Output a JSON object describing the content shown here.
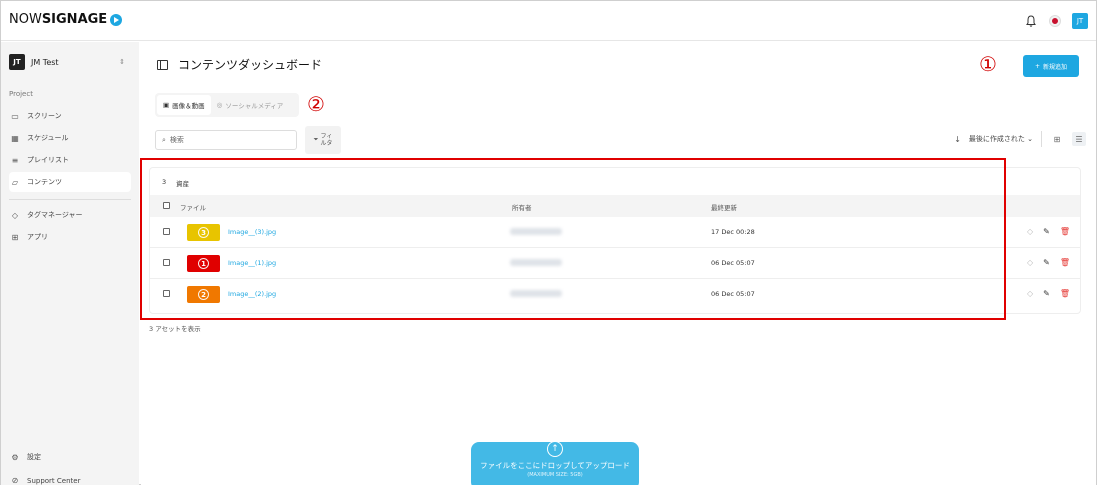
{
  "app": {
    "logo_prefix": "NOW",
    "logo_bold": "SIGNAGE"
  },
  "topbar": {
    "bell_icon": "bell-icon",
    "locale_flag": "japan-flag",
    "user_initials": "JT"
  },
  "sidebar": {
    "workspace_badge": "JT",
    "workspace_name": "JM Test",
    "section_label": "Project",
    "items": [
      {
        "icon": "screen-icon",
        "label": "スクリーン"
      },
      {
        "icon": "calendar-icon",
        "label": "スケジュール"
      },
      {
        "icon": "playlist-icon",
        "label": "プレイリスト"
      },
      {
        "icon": "folder-icon",
        "label": "コンテンツ"
      },
      {
        "icon": "tag-icon",
        "label": "タグマネージャー"
      },
      {
        "icon": "apps-icon",
        "label": "アプリ"
      }
    ],
    "settings_label": "設定",
    "support_label": "Support Center"
  },
  "page": {
    "title": "コンテンツダッシュボード",
    "add_button": "新規追加",
    "annotation_1": "①",
    "annotation_2": "②",
    "tabs": [
      {
        "label": "画像＆動画",
        "active": true
      },
      {
        "label": "ソーシャルメディア",
        "active": false
      }
    ],
    "search_placeholder": "検索",
    "filter_label_line1": "フィ",
    "filter_label_line2": "ルタ",
    "sort_label": "最後に作成された"
  },
  "table": {
    "count": "3",
    "count_label": "資産",
    "headers": {
      "file": "ファイル",
      "owner": "所有者",
      "updated": "最終更新"
    },
    "rows": [
      {
        "thumb_color": "#e8c400",
        "thumb_num": "3",
        "filename": "Image__(3).jpg",
        "updated": "17 Dec 00:28"
      },
      {
        "thumb_color": "#e00000",
        "thumb_num": "1",
        "filename": "Image__(1).jpg",
        "updated": "06 Dec 05:07"
      },
      {
        "thumb_color": "#f07800",
        "thumb_num": "2",
        "filename": "Image__(2).jpg",
        "updated": "06 Dec 05:07"
      }
    ],
    "footer": "3 アセットを表示"
  },
  "upload": {
    "label": "ファイルをここにドロップしてアップロード",
    "sub": "(MAXIMUM SIZE: 5GB)"
  },
  "colors": {
    "accent": "#1ea7e1",
    "highlight_frame": "#e00000",
    "delete": "#e53935"
  }
}
